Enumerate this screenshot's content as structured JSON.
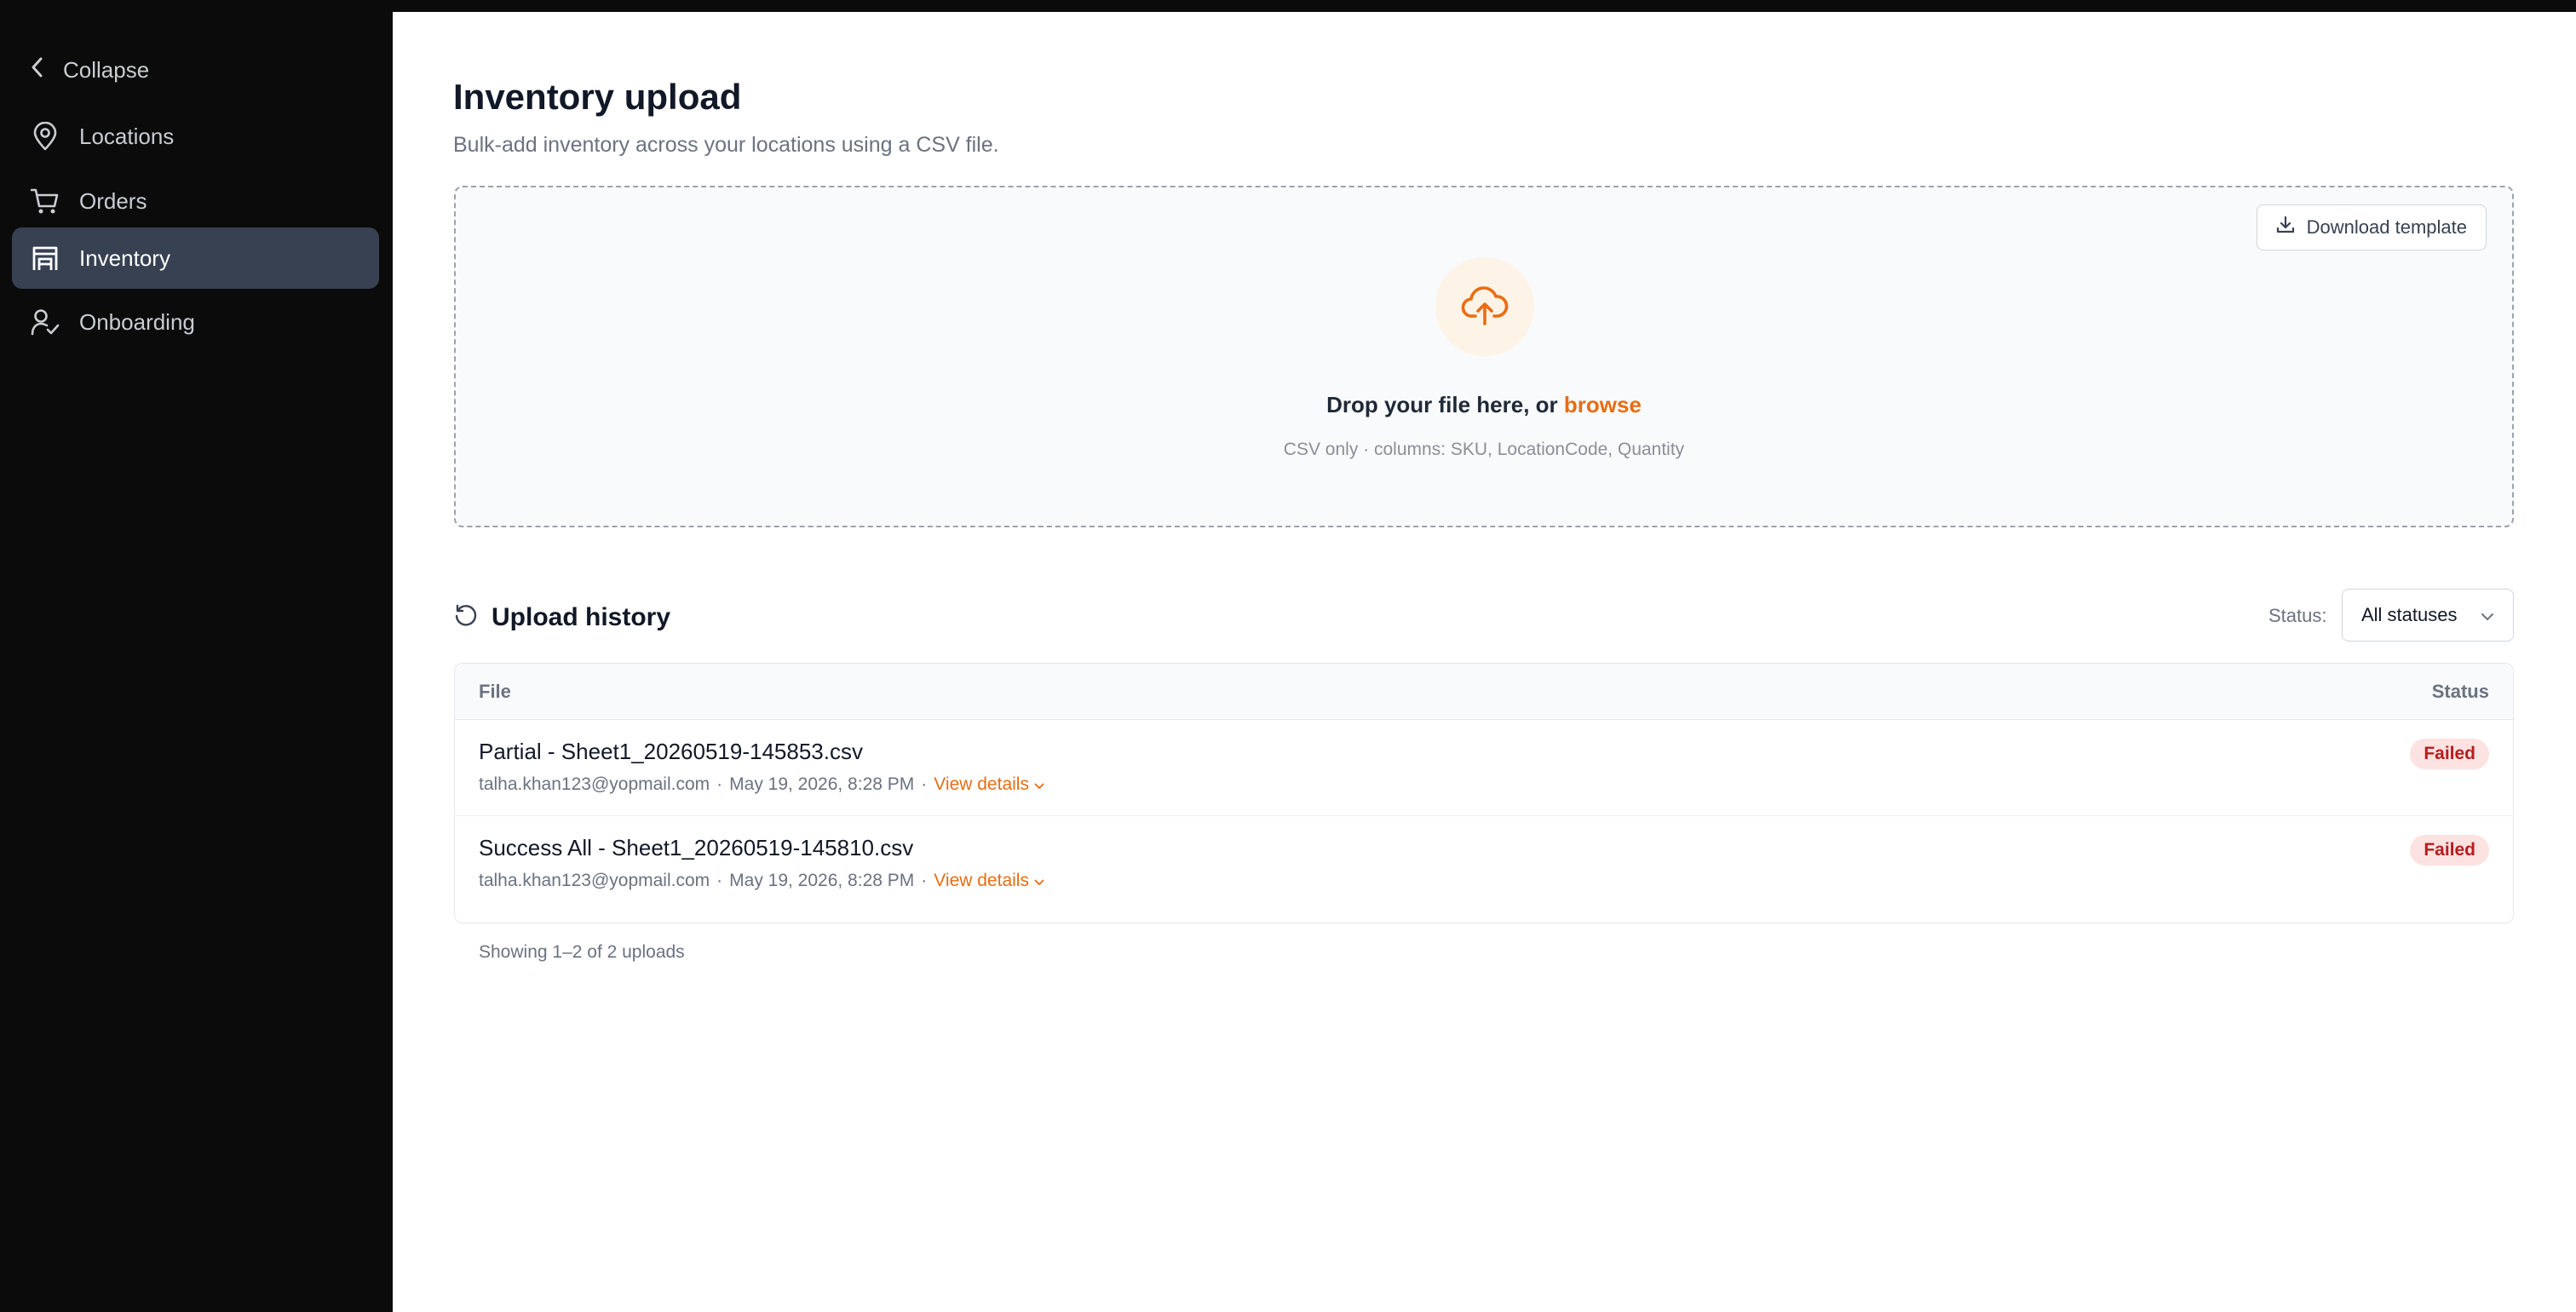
{
  "sidebar": {
    "collapse_label": "Collapse",
    "items": [
      {
        "label": "Locations",
        "icon": "map-pin-icon",
        "active": false
      },
      {
        "label": "Orders",
        "icon": "shopping-cart-icon",
        "active": false
      },
      {
        "label": "Inventory",
        "icon": "warehouse-icon",
        "active": true
      },
      {
        "label": "Onboarding",
        "icon": "user-check-icon",
        "active": false
      }
    ]
  },
  "page": {
    "title": "Inventory upload",
    "subtitle": "Bulk-add inventory across your locations using a CSV file."
  },
  "dropzone": {
    "download_label": "Download template",
    "drop_text": "Drop your file here, or",
    "browse_label": "browse",
    "hint": "CSV only · columns: SKU, LocationCode, Quantity"
  },
  "history": {
    "title": "Upload history",
    "status_filter_label": "Status:",
    "status_filter_value": "All statuses",
    "columns": {
      "file": "File",
      "status": "Status"
    },
    "rows": [
      {
        "file": "Partial - Sheet1_20260519-145853.csv",
        "user": "talha.khan123@yopmail.com",
        "date": "May 19, 2026, 8:28 PM",
        "details_label": "View details",
        "status": "Failed"
      },
      {
        "file": "Success All - Sheet1_20260519-145810.csv",
        "user": "talha.khan123@yopmail.com",
        "date": "May 19, 2026, 8:28 PM",
        "details_label": "View details",
        "status": "Failed"
      }
    ],
    "showing": "Showing 1–2 of 2 uploads"
  },
  "colors": {
    "accent": "#ea6c12",
    "sidebar_bg": "#0b0b0b",
    "active_item_bg": "#374151",
    "failed_bg": "#fde2e2",
    "failed_text": "#b91c1c"
  }
}
